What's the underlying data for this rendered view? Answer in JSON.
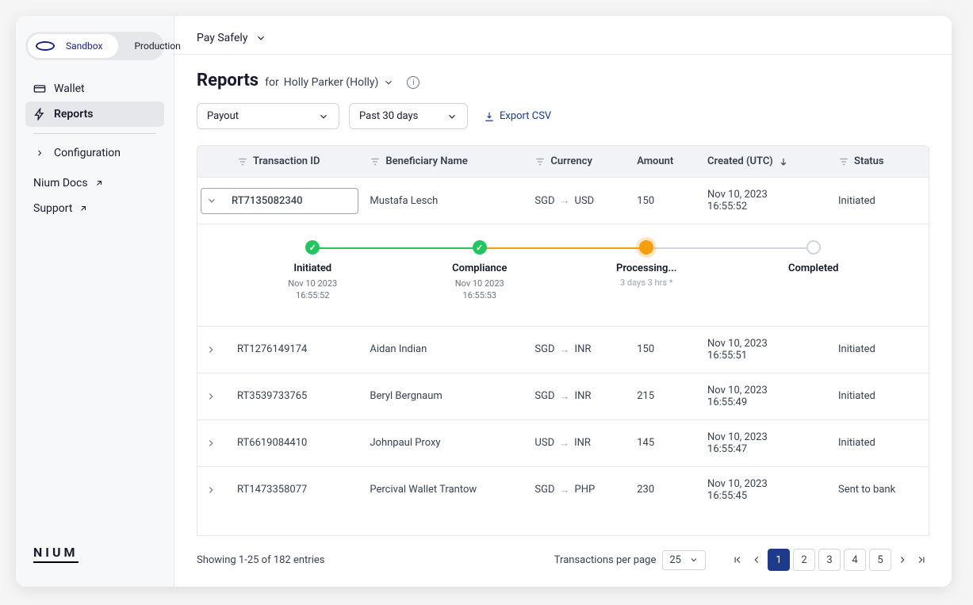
{
  "env": {
    "sandbox": "Sandbox",
    "production": "Production"
  },
  "sidebar": {
    "wallet": "Wallet",
    "reports": "Reports",
    "configuration": "Configuration",
    "docs": "Nium Docs",
    "support": "Support"
  },
  "logo": "NIUM",
  "topbar": {
    "brand": "Pay Safely"
  },
  "header": {
    "title": "Reports",
    "for": "for",
    "entity": "Holly Parker (Holly)"
  },
  "filters": {
    "type": "Payout",
    "range": "Past 30 days",
    "export": "Export CSV"
  },
  "columns": {
    "txn": "Transaction ID",
    "bene": "Beneficiary Name",
    "curr": "Currency",
    "amount": "Amount",
    "created": "Created (UTC)",
    "status": "Status"
  },
  "rows": [
    {
      "id": "RT7135082340",
      "bene": "Mustafa Lesch",
      "from": "SGD",
      "to": "USD",
      "amount": "150",
      "date": "Nov 10, 2023",
      "time": "16:55:52",
      "status": "Initiated",
      "expanded": true,
      "timeline": {
        "initiated": {
          "label": "Initiated",
          "date": "Nov 10 2023",
          "time": "16:55:52"
        },
        "compliance": {
          "label": "Compliance",
          "date": "Nov 10 2023",
          "time": "16:55:53"
        },
        "processing": {
          "label": "Processing...",
          "eta": "3 days 3 hrs *"
        },
        "completed": {
          "label": "Completed"
        }
      }
    },
    {
      "id": "RT1276149174",
      "bene": "Aidan Indian",
      "from": "SGD",
      "to": "INR",
      "amount": "150",
      "date": "Nov 10, 2023",
      "time": "16:55:51",
      "status": "Initiated"
    },
    {
      "id": "RT3539733765",
      "bene": "Beryl Bergnaum",
      "from": "SGD",
      "to": "INR",
      "amount": "215",
      "date": "Nov 10, 2023",
      "time": "16:55:49",
      "status": "Initiated"
    },
    {
      "id": "RT6619084410",
      "bene": "Johnpaul Proxy",
      "from": "USD",
      "to": "INR",
      "amount": "145",
      "date": "Nov 10, 2023",
      "time": "16:55:47",
      "status": "Initiated"
    },
    {
      "id": "RT1473358077",
      "bene": "Percival Wallet Trantow",
      "from": "SGD",
      "to": "PHP",
      "amount": "230",
      "date": "Nov 10, 2023",
      "time": "16:55:45",
      "status": "Sent to bank"
    }
  ],
  "footer": {
    "showing": "Showing 1-25 of 182 entries",
    "perPageLabel": "Transactions per page",
    "perPage": "25",
    "pages": [
      "1",
      "2",
      "3",
      "4",
      "5"
    ],
    "current": 1
  }
}
